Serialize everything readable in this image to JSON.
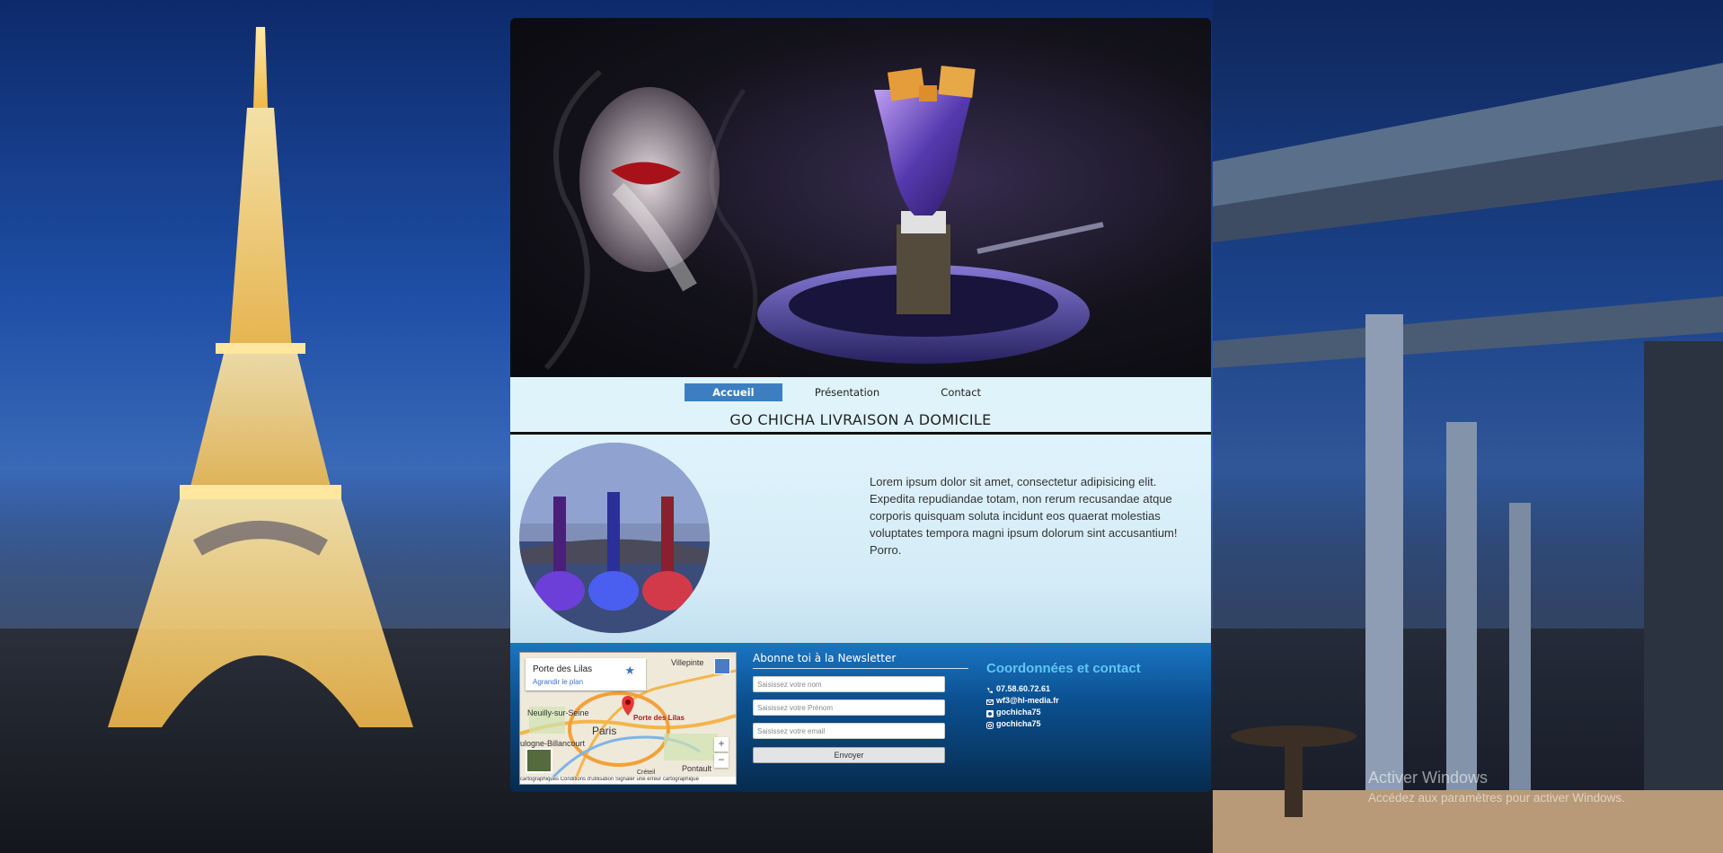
{
  "nav": {
    "items": [
      {
        "label": "Accueil",
        "active": true
      },
      {
        "label": "Présentation",
        "active": false
      },
      {
        "label": "Contact",
        "active": false
      }
    ]
  },
  "main": {
    "title": "GO CHICHA LIVRAISON A DOMICILE",
    "text": "Lorem ipsum dolor sit amet, consectetur adipisicing elit. Expedita repudiandae totam, non rerum recusandae atque corporis quisquam soluta incidunt eos quaerat molestias voluptates tempora magni ipsum dolorum sint accusantium! Porro."
  },
  "map": {
    "place": "Porte des Lilas",
    "enlarge": "Agrandir le plan",
    "labels": {
      "villepinte": "Villepinte",
      "neuilly": "Neuilly-sur-Seine",
      "paris": "Paris",
      "marker": "Porte des Lilas",
      "boulogne": "ulogne-Billancourt",
      "pontault": "Pontault",
      "creteil": "Créteil"
    },
    "zoom_in": "+",
    "zoom_out": "−",
    "footer": "cartographiques   Conditions d'utilisation   Signaler une erreur cartographique"
  },
  "newsletter": {
    "title": "Abonne toi à la Newsletter",
    "name_placeholder": "Saisissez votre nom",
    "firstname_placeholder": "Saisissez votre Prénom",
    "email_placeholder": "Saisissez votre email",
    "submit": "Envoyer"
  },
  "contact": {
    "title": "Coordonnées et contact",
    "phone": "07.58.60.72.61",
    "email": "wf3@hl-media.fr",
    "snapchat": "gochicha75",
    "instagram": "gochicha75"
  },
  "watermark": {
    "line1": "Activer Windows",
    "line2": "Accédez aux paramètres pour activer Windows."
  },
  "colors": {
    "accent": "#3d7ec0",
    "footer": "#0b4f8f",
    "contact_title": "#5fc7f5"
  }
}
